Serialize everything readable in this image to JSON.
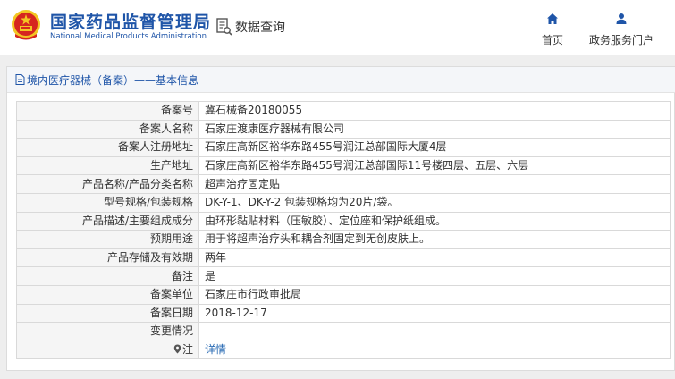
{
  "header": {
    "logo_cn": "国家药品监督管理局",
    "logo_en": "National Medical Products Administration",
    "query_label": "数据查询",
    "nav": [
      {
        "icon": "home-icon",
        "label": "首页"
      },
      {
        "icon": "user-icon",
        "label": "政务服务门户"
      }
    ]
  },
  "panel": {
    "title": "境内医疗器械（备案）——基本信息"
  },
  "rows": [
    {
      "label": "备案号",
      "value": "冀石械备20180055"
    },
    {
      "label": "备案人名称",
      "value": "石家庄渡康医疗器械有限公司"
    },
    {
      "label": "备案人注册地址",
      "value": "石家庄高新区裕华东路455号润江总部国际大厦4层"
    },
    {
      "label": "生产地址",
      "value": "石家庄高新区裕华东路455号润江总部国际11号楼四层、五层、六层"
    },
    {
      "label": "产品名称/产品分类名称",
      "value": "超声治疗固定贴"
    },
    {
      "label": "型号规格/包装规格",
      "value": "DK-Y-1、DK-Y-2 包装规格均为20片/袋。"
    },
    {
      "label": "产品描述/主要组成成分",
      "value": "由环形黏贴材料（压敏胶）、定位座和保护纸组成。"
    },
    {
      "label": "预期用途",
      "value": "用于将超声治疗头和耦合剂固定到无创皮肤上。"
    },
    {
      "label": "产品存储及有效期",
      "value": "两年"
    },
    {
      "label": "备注",
      "value": "是"
    },
    {
      "label": "备案单位",
      "value": "石家庄市行政审批局"
    },
    {
      "label": "备案日期",
      "value": "2018-12-17"
    },
    {
      "label": "变更情况",
      "value": ""
    }
  ],
  "note_row": {
    "label": "注",
    "link": "详情"
  },
  "colors": {
    "brand": "#1f55a8",
    "link": "#2c6db5",
    "logo_red": "#d6261f",
    "logo_gold": "#f3c623"
  }
}
